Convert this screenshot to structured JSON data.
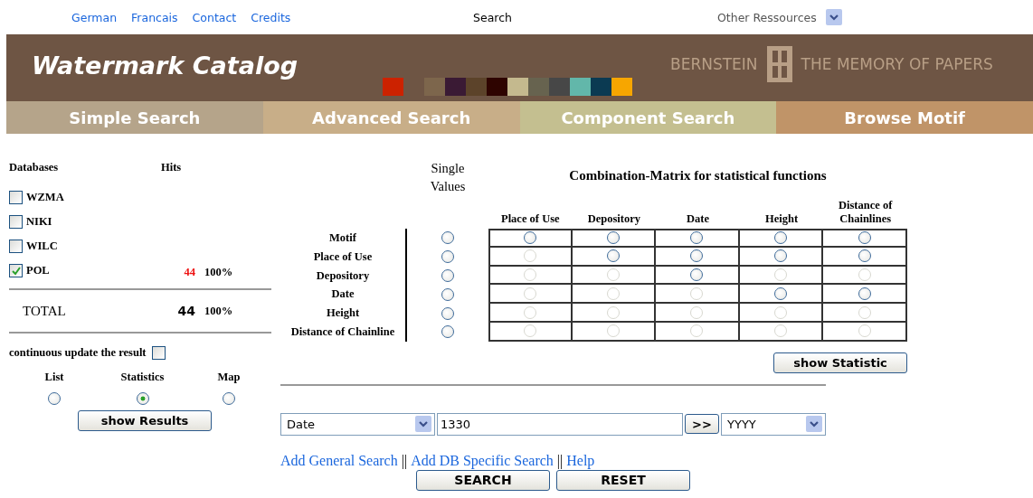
{
  "top_links": [
    "German",
    "Francais",
    "Contact",
    "Credits"
  ],
  "search_label": "Search",
  "other_resources": {
    "label": "Other Ressources"
  },
  "header": {
    "title": "Watermark Catalog",
    "brand_left": "BERNSTEIN",
    "brand_right": "THE MEMORY OF PAPERS"
  },
  "tabs": [
    {
      "label": "Simple Search",
      "color": "#b5a48a"
    },
    {
      "label": "Advanced Search",
      "color": "#c8ae88"
    },
    {
      "label": "Component Search",
      "color": "#c4bf90"
    },
    {
      "label": "Browse Motif",
      "color": "#c09468"
    }
  ],
  "databases": {
    "header": "Databases",
    "hits_header": "Hits",
    "rows": [
      {
        "name": "WZMA",
        "checked": false
      },
      {
        "name": "NIKI",
        "checked": false
      },
      {
        "name": "WILC",
        "checked": false
      },
      {
        "name": "POL",
        "checked": true,
        "hits": "44",
        "percent": "100%"
      }
    ],
    "total": {
      "label": "TOTAL",
      "hits": "44",
      "percent": "100%"
    }
  },
  "continuous_update": {
    "label": "continuous update the result",
    "checked": false
  },
  "view_options": [
    {
      "label": "List",
      "selected": false
    },
    {
      "label": "Statistics",
      "selected": true
    },
    {
      "label": "Map",
      "selected": false
    }
  ],
  "show_results_button": "show Results",
  "matrix": {
    "single_header": "Single Values",
    "title": "Combination-Matrix for statistical functions",
    "columns": [
      "Place of Use",
      "Depository",
      "Date",
      "Height",
      "Distance of Chainlines"
    ],
    "rows": [
      {
        "label": "Motif",
        "single_selected": false,
        "cells": [
          {
            "disabled": false
          },
          {
            "disabled": false
          },
          {
            "disabled": false
          },
          {
            "disabled": false
          },
          {
            "disabled": false
          }
        ]
      },
      {
        "label": "Place of Use",
        "single_selected": false,
        "cells": [
          {
            "disabled": true
          },
          {
            "disabled": false
          },
          {
            "disabled": false
          },
          {
            "disabled": false
          },
          {
            "disabled": false
          }
        ]
      },
      {
        "label": "Depository",
        "single_selected": false,
        "cells": [
          {
            "disabled": true
          },
          {
            "disabled": true
          },
          {
            "disabled": false
          },
          {
            "disabled": true
          },
          {
            "disabled": true
          }
        ]
      },
      {
        "label": "Date",
        "single_selected": false,
        "cells": [
          {
            "disabled": true
          },
          {
            "disabled": true
          },
          {
            "disabled": true
          },
          {
            "disabled": false
          },
          {
            "disabled": false
          }
        ]
      },
      {
        "label": "Height",
        "single_selected": false,
        "cells": [
          {
            "disabled": true
          },
          {
            "disabled": true
          },
          {
            "disabled": true
          },
          {
            "disabled": true
          },
          {
            "disabled": true
          }
        ]
      },
      {
        "label": "Distance of Chainline",
        "single_selected": false,
        "cells": [
          {
            "disabled": true
          },
          {
            "disabled": true
          },
          {
            "disabled": true
          },
          {
            "disabled": true
          },
          {
            "disabled": true
          }
        ]
      }
    ]
  },
  "show_statistic_button": "show Statistic",
  "search_row": {
    "field": "Date",
    "value": "1330",
    "go_button": ">>",
    "format": "YYYY"
  },
  "links": [
    "Add General Search",
    "Add DB Specific Search",
    "Help"
  ],
  "link_separators": [
    "||",
    "||"
  ],
  "buttons": [
    "SEARCH",
    "RESET"
  ]
}
